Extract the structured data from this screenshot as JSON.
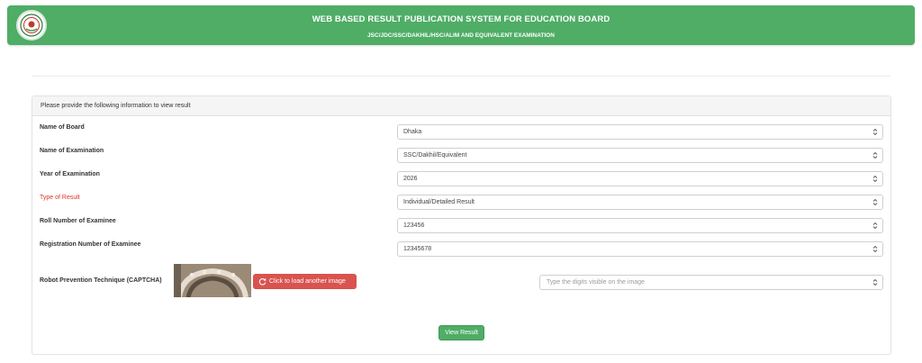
{
  "header": {
    "title": "WEB BASED RESULT PUBLICATION SYSTEM FOR EDUCATION BOARD",
    "subtitle": "JSC/JDC/SSC/DAKHIL/HSC/ALIM AND EQUIVALENT EXAMINATION",
    "logo_icon": "government-seal-icon"
  },
  "panel": {
    "heading": "Please provide the following information to view result"
  },
  "form": {
    "board": {
      "label": "Name of Board",
      "value": "Dhaka"
    },
    "exam": {
      "label": "Name of Examination",
      "value": "SSC/Dakhil/Equivalent"
    },
    "year": {
      "label": "Year of Examination",
      "value": "2026"
    },
    "result_type": {
      "label": "Type of Result",
      "value": "Individual/Detailed Result"
    },
    "roll": {
      "label": "Roll Number of Examinee",
      "value": "123456"
    },
    "registration": {
      "label": "Registration Number of Examinee",
      "value": "12345678"
    },
    "captcha": {
      "label": "Robot Prevention Technique (CAPTCHA)",
      "reload_label": "Click to load another image",
      "placeholder": "Type the digits visible on the image"
    },
    "submit_label": "View Result"
  },
  "colors": {
    "brand_green": "#4fad66",
    "danger": "#d9534f",
    "required_label": "#e0352b"
  }
}
